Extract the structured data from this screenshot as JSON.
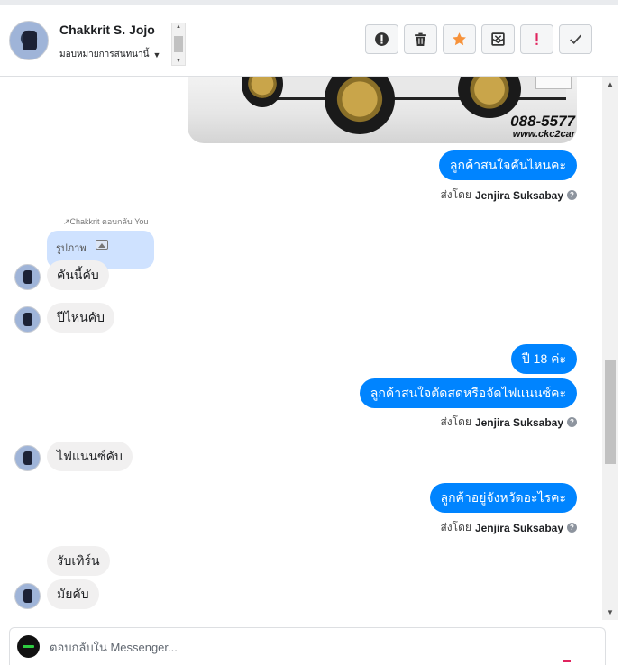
{
  "header": {
    "contact_name": "Chakkrit S. Jojo",
    "assign_label": "มอบหมายการสนทนานี้",
    "actions": [
      {
        "name": "alert-button",
        "icon": "exclamation-circle-icon"
      },
      {
        "name": "delete-button",
        "icon": "trash-icon"
      },
      {
        "name": "star-button",
        "icon": "star-icon"
      },
      {
        "name": "spam-button",
        "icon": "mail-blocked-icon"
      },
      {
        "name": "important-button",
        "icon": "exclamation-icon"
      },
      {
        "name": "done-button",
        "icon": "check-icon"
      }
    ]
  },
  "colors": {
    "outgoing_bubble": "#0084ff",
    "incoming_bubble": "#f1f0f0",
    "reply_quote": "#cfe2ff",
    "star": "#f7923a",
    "important": "#e0245e"
  },
  "thread": {
    "image_watermark_phone": "088-5577",
    "image_watermark_web": "www.ckc2car",
    "sent_by_prefix": "ส่งโดย",
    "agent_name": "Jenjira Suksabay",
    "msg_out_1": "ลูกค้าสนใจคันไหนคะ",
    "reply_note": "Chakkrit ตอบกลับ You",
    "reply_quote_label": "รูปภาพ",
    "msg_in_1": "คันนี้คับ",
    "msg_in_2": "ปีไหนคับ",
    "msg_out_2": "ปี 18 ค่ะ",
    "msg_out_3": "ลูกค้าสนใจตัดสดหรือจัดไฟแนนซ์คะ",
    "msg_in_3": "ไฟแนนซ์คับ",
    "msg_out_4": "ลูกค้าอยู่จังหวัดอะไรคะ",
    "msg_in_4": "รับเทิร์น",
    "msg_in_5": "มัยคับ"
  },
  "composer": {
    "placeholder": "ตอบกลับใน Messenger..."
  }
}
